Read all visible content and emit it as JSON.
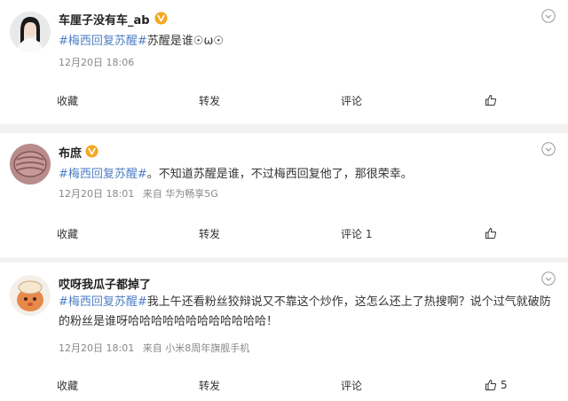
{
  "posts": [
    {
      "username": "车厘子没有车_ab",
      "verified": true,
      "content": {
        "tag": "#梅西回复苏醒#",
        "text": "苏醒是谁☉ω☉"
      },
      "time": "12月20日 18:06",
      "source": "",
      "actions": {
        "favorite": "收藏",
        "forward": "转发",
        "comment": "评论",
        "like": ""
      }
    },
    {
      "username": "布庶",
      "verified": true,
      "content": {
        "tag": "#梅西回复苏醒#",
        "text": "。不知道苏醒是谁，不过梅西回复他了，那很荣幸。"
      },
      "time": "12月20日 18:01",
      "source": "来自 华为畅享5G",
      "actions": {
        "favorite": "收藏",
        "forward": "转发",
        "comment": "评论 1",
        "like": ""
      }
    },
    {
      "username": "哎呀我瓜子都掉了",
      "verified": false,
      "content": {
        "tag": "#梅西回复苏醒#",
        "text": "我上午还看粉丝狡辩说又不靠这个炒作，这怎么还上了热搜啊？说个过气就破防的粉丝是谁呀哈哈哈哈哈哈哈哈哈哈哈哈！"
      },
      "time": "12月20日 18:01",
      "source": "来自 小米8周年旗舰手机",
      "actions": {
        "favorite": "收藏",
        "forward": "转发",
        "comment": "评论",
        "like": "5"
      }
    }
  ],
  "icons": {
    "more": "chevron-down-icon",
    "like": "thumbs-up-icon",
    "verified": "verified-badge-icon"
  },
  "colors": {
    "tag": "#4f7fc4",
    "verified_badge": "#f5a623",
    "background": "#f2f2f2"
  }
}
